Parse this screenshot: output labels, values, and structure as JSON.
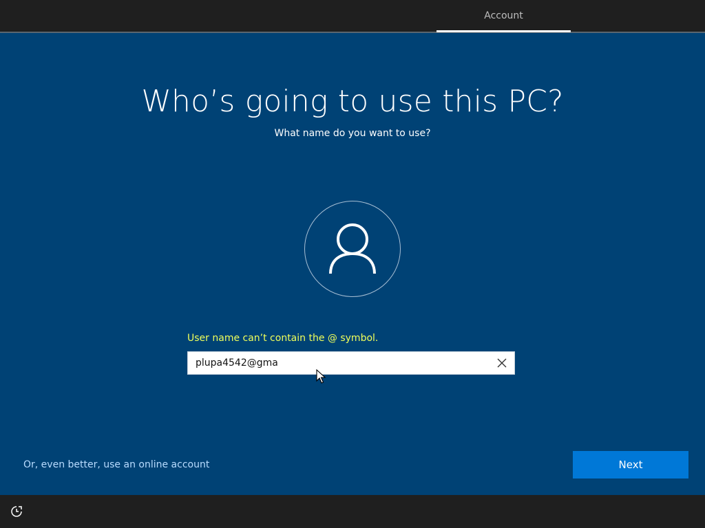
{
  "header": {
    "tab_label": "Account"
  },
  "main": {
    "title": "Who’s going to use this PC?",
    "subtitle": "What name do you want to use?",
    "error": "User name can’t contain the @ symbol.",
    "username_value": "plupa4542@gma",
    "online_account_link": "Or, even better, use an online account",
    "next_label": "Next"
  },
  "icons": {
    "avatar": "user-icon",
    "clear": "close-icon",
    "accessibility": "ease-of-access-icon",
    "pointer": "mouse-pointer-icon"
  },
  "colors": {
    "background": "#004275",
    "bar": "#1f1f1f",
    "accent": "#0078d7",
    "error": "#f0ff5a",
    "link": "#b9dcff"
  }
}
